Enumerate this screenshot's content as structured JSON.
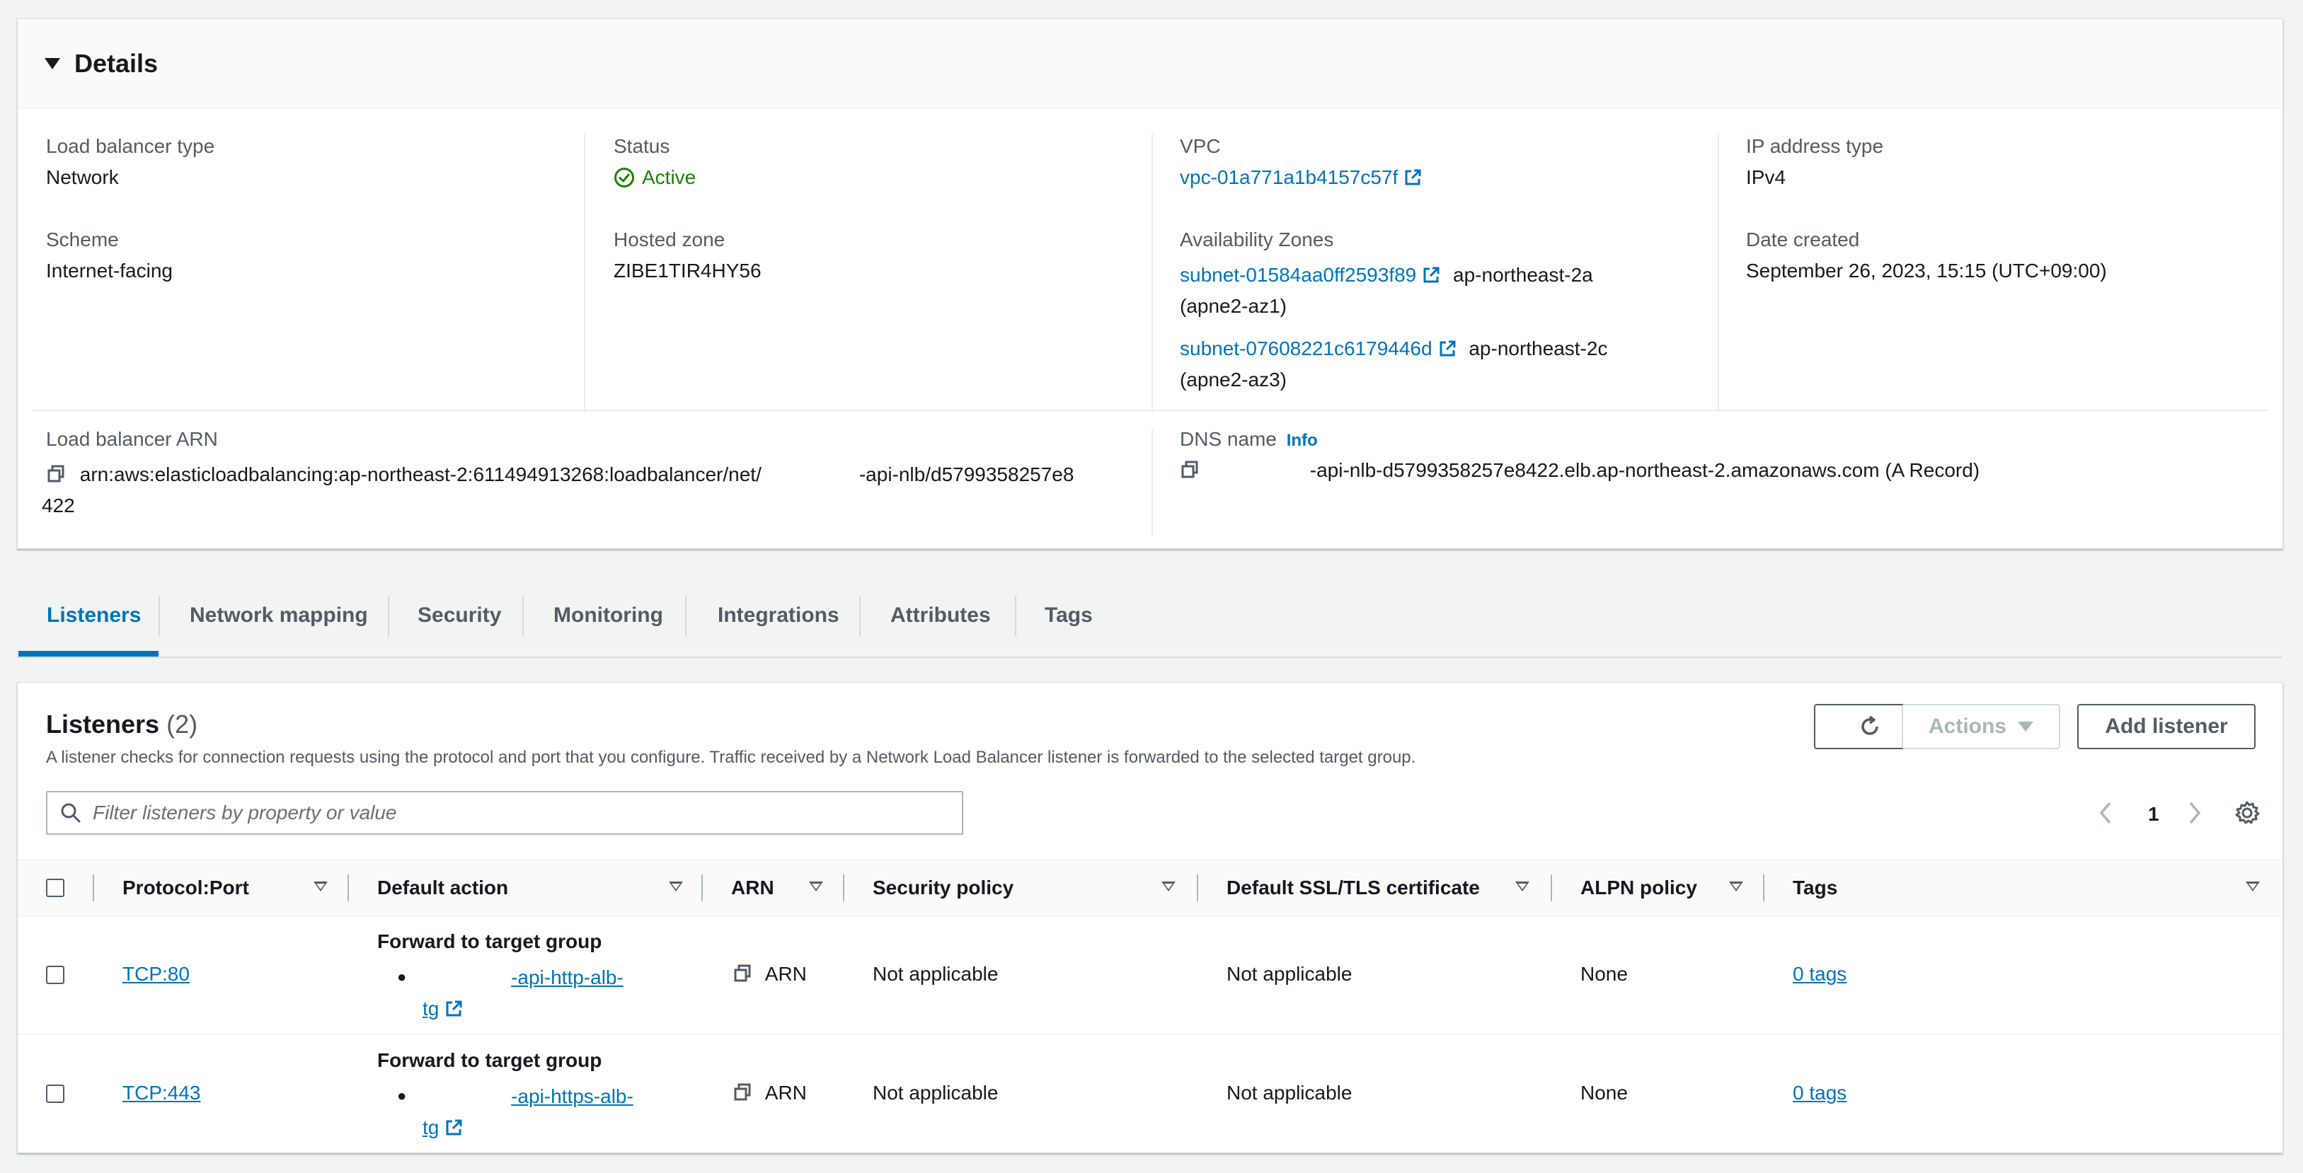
{
  "details": {
    "title": "Details",
    "load_balancer_type": {
      "label": "Load balancer type",
      "value": "Network"
    },
    "status": {
      "label": "Status",
      "value": "Active"
    },
    "vpc": {
      "label": "VPC",
      "value": "vpc-01a771a1b4157c57f"
    },
    "ip_address_type": {
      "label": "IP address type",
      "value": "IPv4"
    },
    "scheme": {
      "label": "Scheme",
      "value": "Internet-facing"
    },
    "hosted_zone": {
      "label": "Hosted zone",
      "value": "ZIBE1TIR4HY56"
    },
    "availability_zones": {
      "label": "Availability Zones",
      "items": [
        {
          "subnet": "subnet-01584aa0ff2593f89",
          "zone": "ap-northeast-2a",
          "zone_id": "(apne2-az1)"
        },
        {
          "subnet": "subnet-07608221c6179446d",
          "zone": "ap-northeast-2c",
          "zone_id": "(apne2-az3)"
        }
      ]
    },
    "date_created": {
      "label": "Date created",
      "value": "September 26, 2023, 15:15 (UTC+09:00)"
    },
    "arn": {
      "label": "Load balancer ARN",
      "value_part1": "arn:aws:elasticloadbalancing:ap-northeast-2:611494913268:loadbalancer/net/",
      "value_part2": "-api-nlb/d5799358257e8",
      "value_part3": "422"
    },
    "dns": {
      "label": "DNS name",
      "info": "Info",
      "value": "-api-nlb-d5799358257e8422.elb.ap-northeast-2.amazonaws.com (A Record)"
    }
  },
  "tabs": [
    "Listeners",
    "Network mapping",
    "Security",
    "Monitoring",
    "Integrations",
    "Attributes",
    "Tags"
  ],
  "listeners": {
    "title": "Listeners",
    "count": "(2)",
    "description": "A listener checks for connection requests using the protocol and port that you configure. Traffic received by a Network Load Balancer listener is forwarded to the selected target group.",
    "actions_label": "Actions",
    "add_label": "Add listener",
    "search_placeholder": "Filter listeners by property or value",
    "page": "1",
    "columns": [
      "Protocol:Port",
      "Default action",
      "ARN",
      "Security policy",
      "Default SSL/TLS certificate",
      "ALPN policy",
      "Tags"
    ],
    "rows": [
      {
        "protocol_port": "TCP:80",
        "action_title": "Forward to target group",
        "target_part1": "-api-http-alb-",
        "target_part2": "tg",
        "arn": "ARN",
        "security_policy": "Not applicable",
        "certificate": "Not applicable",
        "alpn": "None",
        "tags": "0 tags"
      },
      {
        "protocol_port": "TCP:443",
        "action_title": "Forward to target group",
        "target_part1": "-api-https-alb-",
        "target_part2": "tg",
        "arn": "ARN",
        "security_policy": "Not applicable",
        "certificate": "Not applicable",
        "alpn": "None",
        "tags": "0 tags"
      }
    ]
  },
  "colors": {
    "link": "#0073bb",
    "success": "#1d8102",
    "border": "#d5dbdb"
  }
}
